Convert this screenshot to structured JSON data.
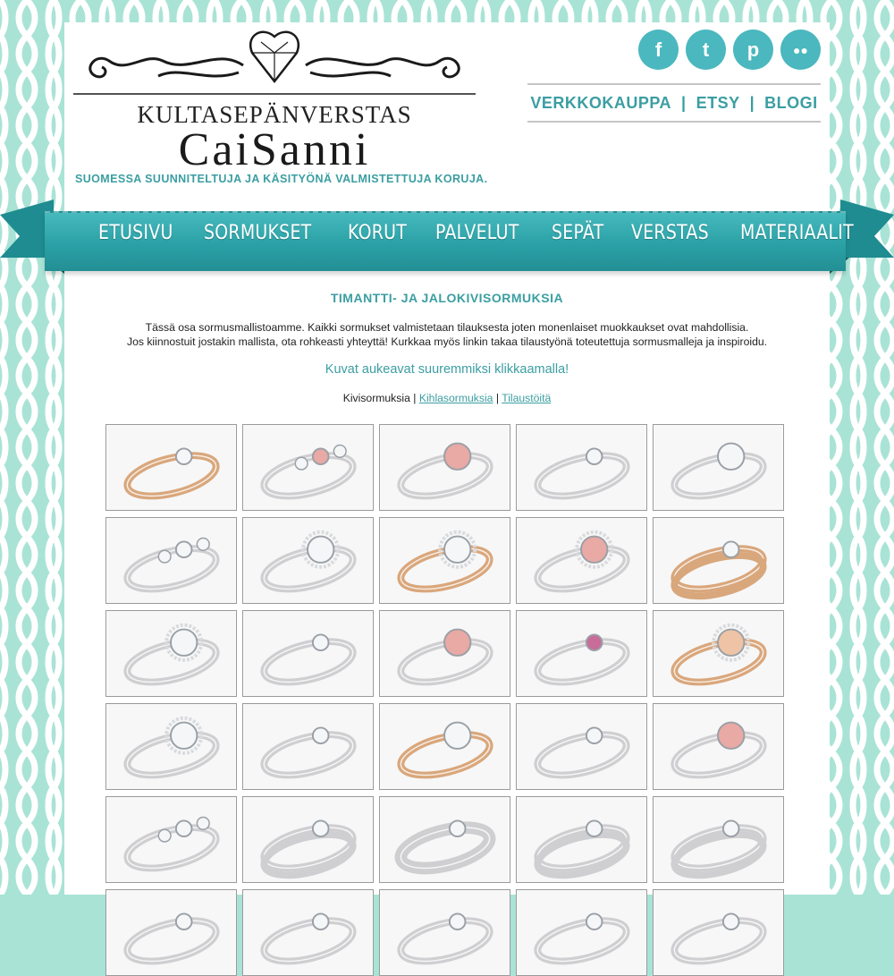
{
  "header": {
    "logo_line1": "KULTASEPÄNVERSTAS",
    "logo_line2": "CaiSanni",
    "tagline": "SUOMESSA SUUNNITELTUJA JA KÄSITYÖNÄ VALMISTETTUJA KORUJA."
  },
  "social": [
    {
      "icon": "facebook-icon",
      "glyph": "f"
    },
    {
      "icon": "twitter-icon",
      "glyph": "t"
    },
    {
      "icon": "pinterest-icon",
      "glyph": "p"
    },
    {
      "icon": "flickr-icon",
      "glyph": "●●"
    }
  ],
  "toplinks": {
    "shop": "VERKKOKAUPPA",
    "sep1": "|",
    "etsy": "ETSY",
    "sep2": "|",
    "blog": "BLOGI"
  },
  "nav": [
    "ETUSIVU",
    "SORMUKSET",
    "KORUT",
    "PALVELUT",
    "SEPÄT",
    "VERSTAS",
    "MATERIAALIT"
  ],
  "content": {
    "heading": "TIMANTTI- JA JALOKIVISORMUKSIA",
    "intro_line1": "Tässä osa sormusmallistoamme. Kaikki sormukset valmistetaan tilauksesta joten monenlaiset muokkaukset ovat mahdollisia.",
    "intro_line2": "Jos kiinnostuit jostakin mallista, ota rohkeasti yhteyttä! Kurkkaa myös linkin takaa tilaustyönä toteutettuja sormusmalleja ja inspiroidu.",
    "click_hint": "Kuvat aukeavat suuremmiksi klikkaamalla!",
    "filter_current": "Kivisormuksia",
    "filter_sep": "|",
    "filter_engagement": "Kihlasormuksia",
    "filter_custom": "Tilaustöitä"
  },
  "colors": {
    "accent": "#3b9ea2",
    "ribbon": "#2aa1a6",
    "background": "#a9e3d6"
  },
  "thumbnails": [
    {
      "metal": "gold",
      "stone": "white",
      "style": "twisted"
    },
    {
      "metal": "white",
      "stone": "pink",
      "style": "three-stone"
    },
    {
      "metal": "white",
      "stone": "pink",
      "style": "solitaire"
    },
    {
      "metal": "white",
      "stone": "white",
      "style": "band"
    },
    {
      "metal": "white",
      "stone": "white",
      "style": "solitaire"
    },
    {
      "metal": "white",
      "stone": "white",
      "style": "three-stone"
    },
    {
      "metal": "white",
      "stone": "white",
      "style": "halo"
    },
    {
      "metal": "gold",
      "stone": "white",
      "style": "cluster"
    },
    {
      "metal": "white",
      "stone": "pink",
      "style": "halo"
    },
    {
      "metal": "gold",
      "stone": "white",
      "style": "double-band"
    },
    {
      "metal": "white",
      "stone": "white",
      "style": "cluster"
    },
    {
      "metal": "white",
      "stone": "white",
      "style": "eternity"
    },
    {
      "metal": "white",
      "stone": "pink",
      "style": "cushion"
    },
    {
      "metal": "white",
      "stone": "multi",
      "style": "half-eternity"
    },
    {
      "metal": "gold",
      "stone": "peach",
      "style": "halo"
    },
    {
      "metal": "white",
      "stone": "white",
      "style": "halo"
    },
    {
      "metal": "white",
      "stone": "white",
      "style": "twisted"
    },
    {
      "metal": "gold",
      "stone": "white",
      "style": "solitaire"
    },
    {
      "metal": "white",
      "stone": "white",
      "style": "band"
    },
    {
      "metal": "white",
      "stone": "pink",
      "style": "solitaire"
    },
    {
      "metal": "white",
      "stone": "white",
      "style": "three-stone"
    },
    {
      "metal": "white",
      "stone": "white",
      "style": "double-band"
    },
    {
      "metal": "white",
      "stone": "white",
      "style": "wide-band"
    },
    {
      "metal": "white",
      "stone": "white",
      "style": "pair"
    },
    {
      "metal": "white",
      "stone": "white",
      "style": "pair"
    },
    {
      "metal": "white",
      "stone": "white",
      "style": "band"
    },
    {
      "metal": "white",
      "stone": "white",
      "style": "band"
    },
    {
      "metal": "white",
      "stone": "white",
      "style": "band"
    },
    {
      "metal": "white",
      "stone": "white",
      "style": "band"
    },
    {
      "metal": "white",
      "stone": "white",
      "style": "band"
    }
  ]
}
